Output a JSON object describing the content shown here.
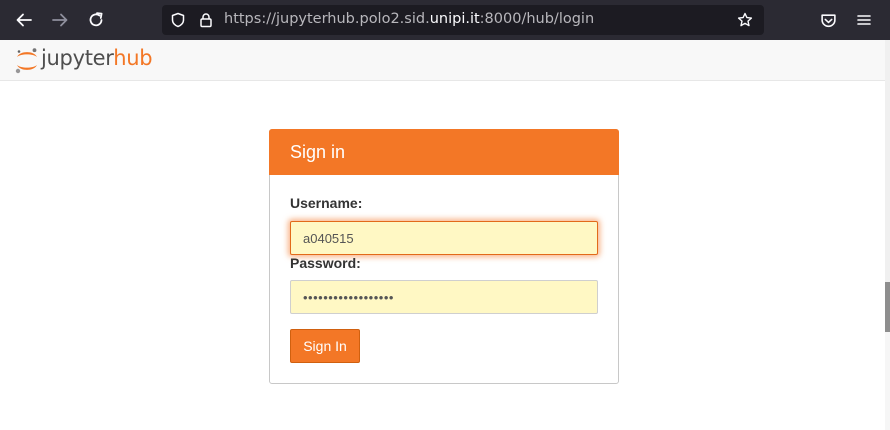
{
  "browser": {
    "url_prefix": "https://jupyterhub.polo2.sid.",
    "url_domain": "unipi.it",
    "url_suffix": ":8000/hub/login"
  },
  "header": {
    "logo_part1": "jupyter",
    "logo_part2": "hub"
  },
  "login": {
    "panel_title": "Sign in",
    "username_label": "Username:",
    "username_value": "a040515",
    "password_label": "Password:",
    "password_value": "••••••••••••••••••",
    "submit_label": "Sign In"
  },
  "colors": {
    "accent": "#f37726",
    "browser_toolbar": "#2b2a33",
    "url_field": "#1c1b22",
    "input_autofill": "#fff8c4"
  }
}
